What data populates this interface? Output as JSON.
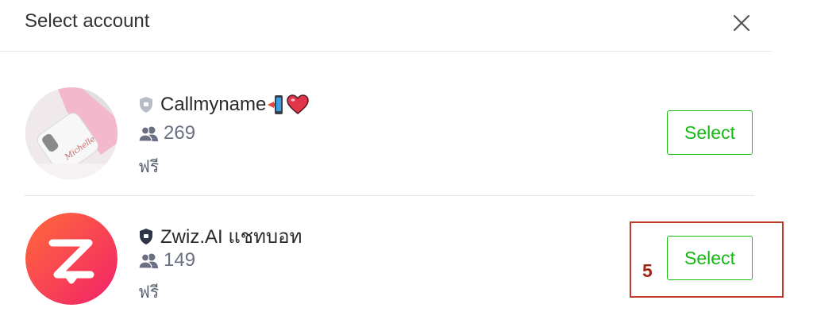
{
  "dialog": {
    "title": "Select account"
  },
  "accounts": [
    {
      "name": "Callmyname",
      "emojis": [
        "mobile-phone-icon",
        "heart-icon"
      ],
      "followers": "269",
      "plan": "ฟรี",
      "select_label": "Select",
      "avatar": "phone-case-photo",
      "shield_color": "#b8bcc6"
    },
    {
      "name": "Zwiz.AI แชทบอท",
      "followers": "149",
      "plan": "ฟรี",
      "select_label": "Select",
      "avatar": "zwiz-logo",
      "shield_color": "#2f3547"
    }
  ],
  "annotation": {
    "step_number": "5",
    "color": "#c0392b"
  },
  "colors": {
    "accent": "#14c014",
    "muted": "#6a7081"
  }
}
